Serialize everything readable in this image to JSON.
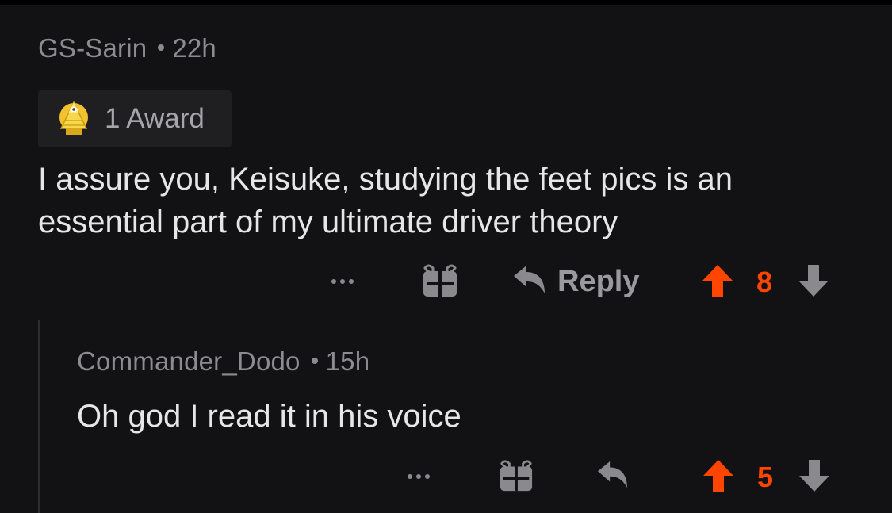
{
  "comment": {
    "author": "GS-Sarin",
    "age": "22h",
    "award_label": "1 Award",
    "body_lines": [
      "I assure you, Keisuke, studying the feet pics is an",
      "essential part of my ultimate driver theory"
    ],
    "reply_label": "Reply",
    "score": "8"
  },
  "reply": {
    "author": "Commander_Dodo",
    "age": "15h",
    "body": "Oh god I read it in his voice",
    "score": "5"
  },
  "colors": {
    "background": "#121214",
    "upvote_active": "#ff4500",
    "icon_gray": "#8a8a8e",
    "text": "#e6e6e8",
    "meta_text": "#8c8c90"
  },
  "icons": [
    "more-icon",
    "gift-icon",
    "reply-icon",
    "upvote-icon",
    "downvote-icon",
    "award-pyramid-icon"
  ]
}
